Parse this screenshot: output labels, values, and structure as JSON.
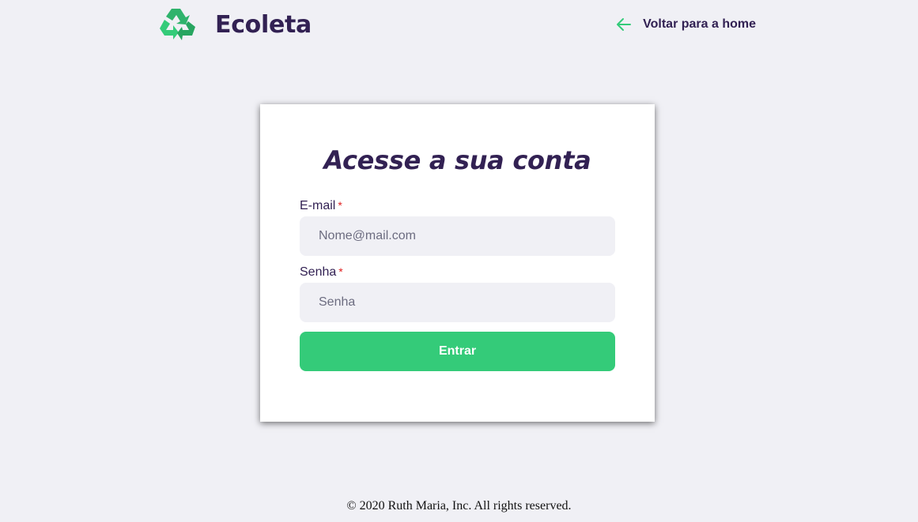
{
  "header": {
    "brand_name": "Ecoleta",
    "back_link_label": "Voltar para a home",
    "logo_icon": "recycle-icon",
    "back_icon": "arrow-left-icon"
  },
  "login": {
    "title": "Acesse a sua conta",
    "email_label": "E-mail",
    "email_placeholder": "Nome@mail.com",
    "email_value": "",
    "password_label": "Senha",
    "password_placeholder": "Senha",
    "password_value": "",
    "required_marker": "*",
    "submit_label": "Entrar"
  },
  "footer": {
    "copyright": "© 2020 Ruth Maria, Inc. All rights reserved."
  },
  "colors": {
    "background": "#f0f0f5",
    "primary_green": "#34cb79",
    "title_purple": "#322153",
    "required_red": "#e02020",
    "card": "#ffffff"
  }
}
